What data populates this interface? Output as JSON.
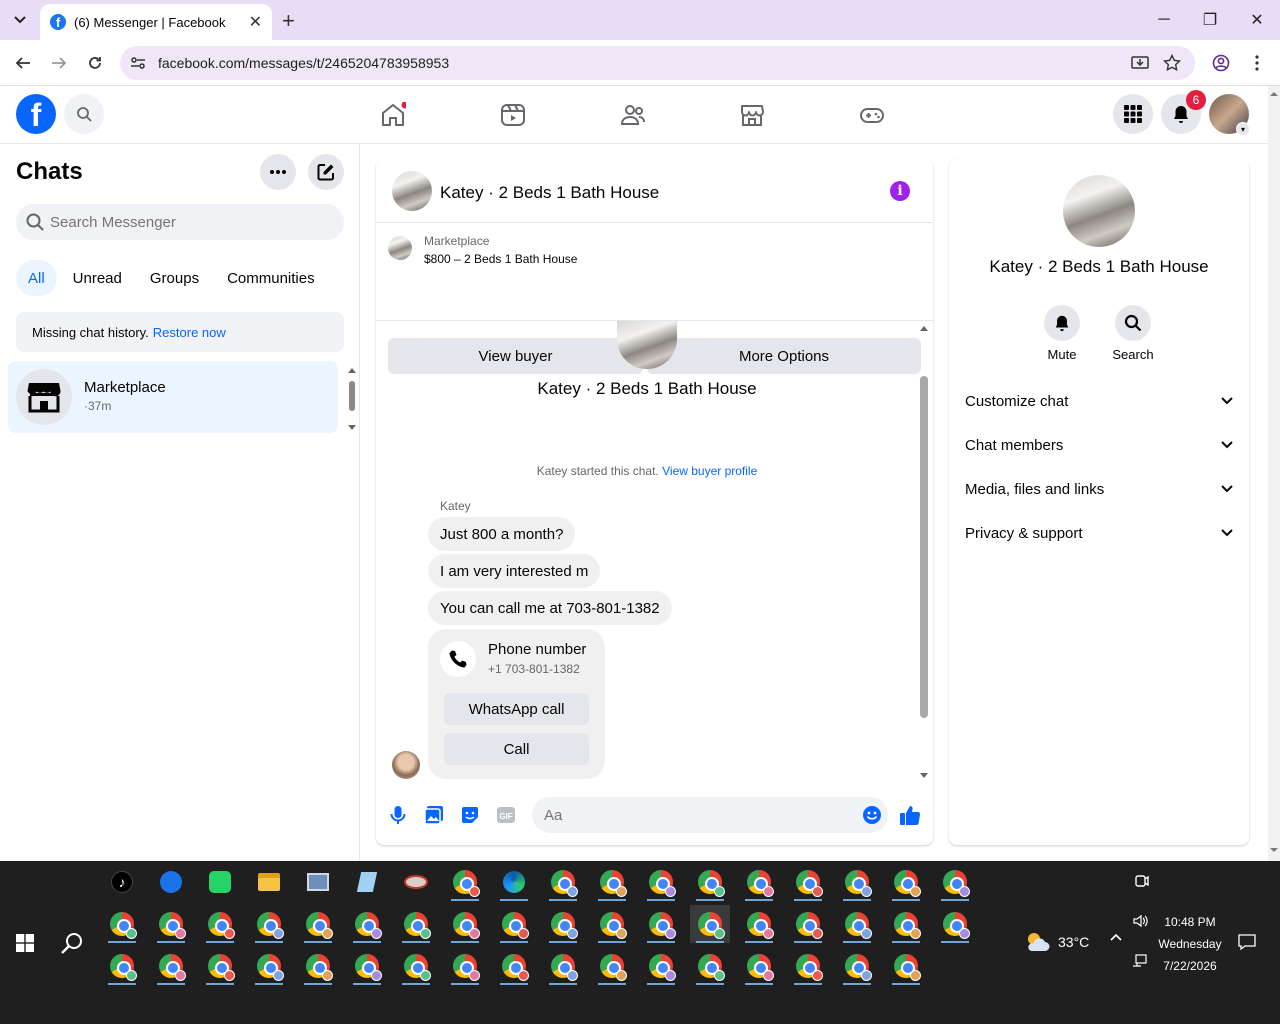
{
  "browser": {
    "tab_title": "(6) Messenger | Facebook",
    "new_tab": "+",
    "url": "facebook.com/messages/t/2465204783958953",
    "window_controls": {
      "minimize": "─",
      "restore": "❐",
      "close": "✕"
    }
  },
  "fb_header": {
    "logo": "f",
    "notifications_count": "6",
    "nav_icons": [
      "home-icon",
      "video-icon",
      "friends-icon",
      "marketplace-icon",
      "gaming-icon"
    ],
    "right_icons": [
      "menu-grid-icon",
      "bell-icon",
      "profile-avatar"
    ]
  },
  "sidebar": {
    "title": "Chats",
    "search_placeholder": "Search Messenger",
    "filters": [
      "All",
      "Unread",
      "Groups",
      "Communities"
    ],
    "missing_history_text": "Missing chat history.",
    "restore_link": "Restore now",
    "chat_items": [
      {
        "name": "Marketplace",
        "time": "·37m"
      }
    ]
  },
  "conversation": {
    "title": "Katey · 2 Beds 1 Bath House",
    "marketplace_label": "Marketplace",
    "listing": "$800 – 2 Beds 1 Bath House",
    "view_buyer_button": "View buyer",
    "more_options_button": "More Options",
    "intro_name": "Katey · 2 Beds 1 Bath House",
    "started_text": "Katey started this chat.",
    "view_buyer_profile_link": "View buyer profile",
    "sender_name": "Katey",
    "messages": [
      "Just 800 a month?",
      "I am very interested m",
      "You can call me at 703-801-1382"
    ],
    "phone_card": {
      "title": "Phone number",
      "number": "+1 703-801-1382",
      "whatsapp_button": "WhatsApp call",
      "call_button": "Call"
    },
    "composer_placeholder": "Aa",
    "gif_label": "GIF"
  },
  "details_panel": {
    "name": "Katey · 2 Beds 1 Bath House",
    "actions": [
      {
        "label": "Mute",
        "icon": "bell-icon"
      },
      {
        "label": "Search",
        "icon": "search-icon"
      }
    ],
    "sections": [
      "Customize chat",
      "Chat members",
      "Media, files and links",
      "Privacy & support"
    ]
  },
  "taskbar": {
    "temperature": "33°C",
    "time": "10:48 PM",
    "day": "Wednesday",
    "date": "7/22/2026"
  },
  "colors": {
    "brand_blue": "#0866ff",
    "notification_red": "#e41e3f",
    "info_purple": "#a020f0",
    "tabbar_bg": "#e9dcf5",
    "taskbar_bg": "#1f1f1f"
  }
}
